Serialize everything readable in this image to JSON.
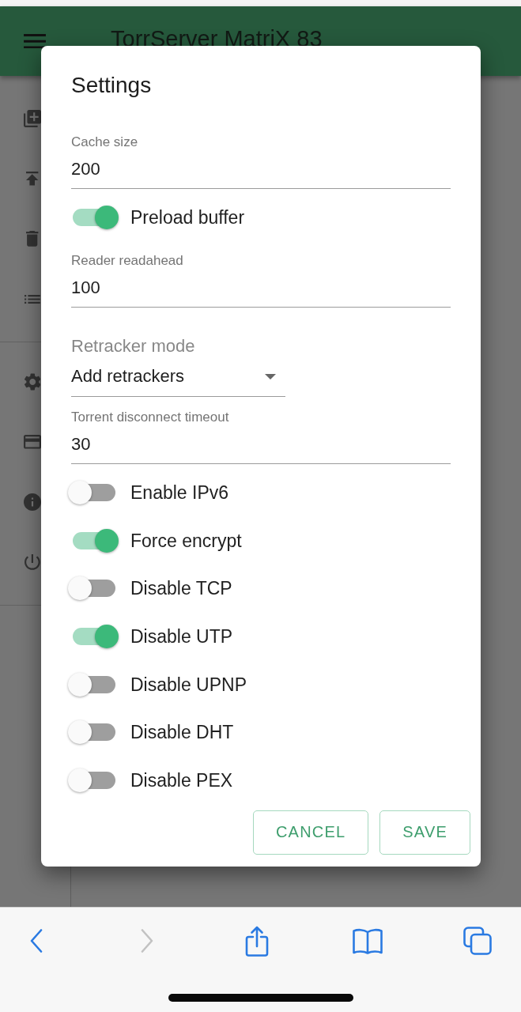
{
  "app_bar": {
    "title": "TorrServer MatriX 83"
  },
  "dialog": {
    "title": "Settings",
    "fields": [
      {
        "kind": "text",
        "label": "Cache size",
        "value": "200"
      },
      {
        "kind": "switch",
        "label": "Preload buffer",
        "on": true
      },
      {
        "kind": "text",
        "label": "Reader readahead",
        "value": "100"
      },
      {
        "kind": "select",
        "label": "Retracker mode",
        "value": "Add retrackers"
      },
      {
        "kind": "text",
        "label": "Torrent disconnect timeout",
        "value": "30"
      },
      {
        "kind": "switch",
        "label": "Enable IPv6",
        "on": false
      },
      {
        "kind": "switch",
        "label": "Force encrypt",
        "on": true
      },
      {
        "kind": "switch",
        "label": "Disable TCP",
        "on": false
      },
      {
        "kind": "switch",
        "label": "Disable UTP",
        "on": true
      },
      {
        "kind": "switch",
        "label": "Disable UPNP",
        "on": false
      },
      {
        "kind": "switch",
        "label": "Disable DHT",
        "on": false
      },
      {
        "kind": "switch",
        "label": "Disable PEX",
        "on": false
      }
    ],
    "buttons": [
      "CANCEL",
      "SAVE"
    ]
  },
  "browser_toolbar": {
    "buttons": [
      {
        "kind": "back",
        "disabled": false
      },
      {
        "kind": "forward",
        "disabled": true
      },
      {
        "kind": "share",
        "disabled": false
      },
      {
        "kind": "bookmarks",
        "disabled": false
      },
      {
        "kind": "tabs",
        "disabled": false
      }
    ]
  }
}
